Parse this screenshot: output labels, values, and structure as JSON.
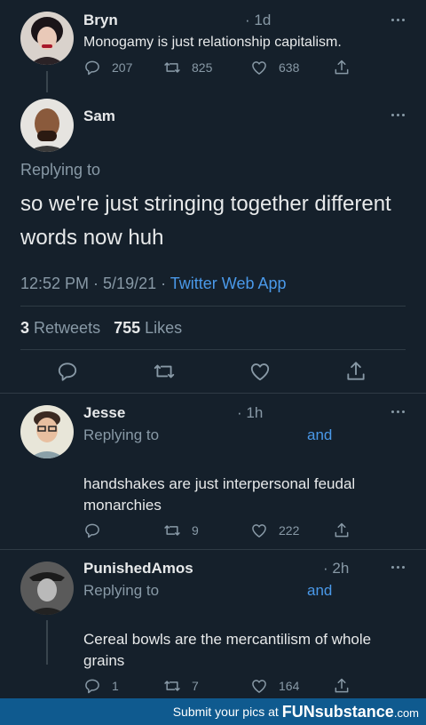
{
  "colors": {
    "background": "#15202b",
    "link": "#4a99e9",
    "muted": "#8899a6",
    "footer": "#0f5a8f"
  },
  "tweet1": {
    "name": "Bryn",
    "time": "· 1d",
    "text": "Monogamy is just relationship capitalism.",
    "replies": "207",
    "retweets": "825",
    "likes": "638"
  },
  "main": {
    "name": "Sam",
    "replying_to": "Replying to",
    "text": "so we're just stringing together different words now huh",
    "timestamp": "12:52 PM · 5/19/21 · ",
    "source": "Twitter Web App",
    "retweet_count": "3",
    "retweet_label": "Retweets",
    "like_count": "755",
    "like_label": "Likes"
  },
  "reply1": {
    "name": "Jesse",
    "time": "· 1h",
    "replying_to": "Replying to",
    "and": "and",
    "text": "handshakes are just interpersonal feudal monarchies",
    "replies": "",
    "retweets": "9",
    "likes": "222"
  },
  "reply2": {
    "name": "PunishedAmos",
    "time": "· 2h",
    "replying_to": "Replying to",
    "and": "and",
    "text": "Cereal bowls are the mercantilism of whole grains",
    "replies": "1",
    "retweets": "7",
    "likes": "164"
  },
  "footer": {
    "text": "Submit your pics at",
    "brand_a": "FUN",
    "brand_b": "substance",
    "brand_c": ".com"
  },
  "icons": [
    "reply-icon",
    "retweet-icon",
    "like-icon",
    "share-icon",
    "more-icon"
  ]
}
